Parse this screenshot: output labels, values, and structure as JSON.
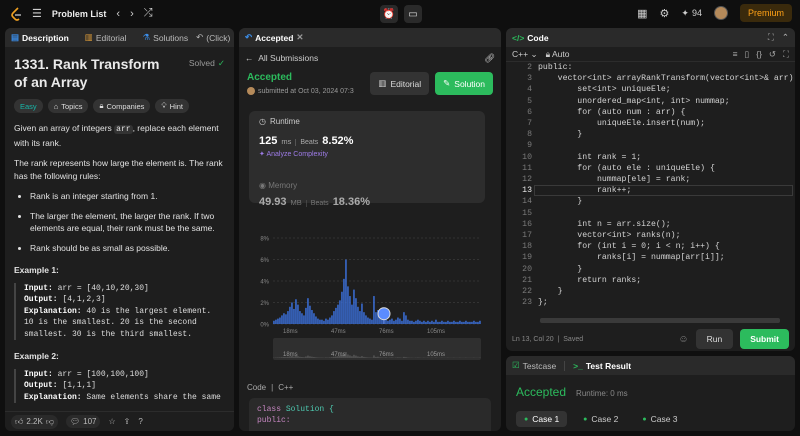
{
  "topbar": {
    "title": "Problem List",
    "streak": "94",
    "premium": "Premium"
  },
  "left": {
    "tabs": [
      "Description",
      "Editorial",
      "Solutions",
      "(Click)"
    ],
    "title": "1331. Rank Transform of an Array",
    "solved": "Solved",
    "chips": [
      "Easy",
      "Topics",
      "Companies",
      "Hint"
    ],
    "desc1a": "Given an array of integers ",
    "desc1code": "arr",
    "desc1b": ", replace each element with its rank.",
    "desc2": "The rank represents how large the element is. The rank has the following rules:",
    "rules": [
      "Rank is an integer starting from 1.",
      "The larger the element, the larger the rank. If two elements are equal, their rank must be the same.",
      "Rank should be as small as possible."
    ],
    "ex1_title": "Example 1:",
    "ex1_input_lbl": "Input:",
    "ex1_input": " arr = [40,10,20,30]",
    "ex1_output_lbl": "Output:",
    "ex1_output": " [4,1,2,3]",
    "ex1_expl_lbl": "Explanation:",
    "ex1_expl": " 40 is the largest element. 10 is the smallest. 20 is the second smallest. 30 is the third smallest.",
    "ex2_title": "Example 2:",
    "ex2_input_lbl": "Input:",
    "ex2_input": " arr = [100,100,100]",
    "ex2_output_lbl": "Output:",
    "ex2_output": " [1,1,1]",
    "ex2_expl_lbl": "Explanation:",
    "ex2_expl": " Same elements share the same",
    "likes": "2.2K",
    "comments": "107"
  },
  "middle": {
    "tab": "Accepted",
    "all_submissions": "All Submissions",
    "status": "Accepted",
    "submitted": "submitted at Oct 03, 2024 07:3",
    "editorial_btn": "Editorial",
    "solution_btn": "Solution",
    "runtime_label": "Runtime",
    "runtime_val": "125",
    "runtime_unit": "ms",
    "beats_label": "Beats",
    "runtime_beats": "8.52%",
    "analyze": "Analyze Complexity",
    "memory_label": "Memory",
    "memory_val": "49.93",
    "memory_unit": "MB",
    "memory_beats": "18.36%",
    "code_label": "Code",
    "code_lang": "C++",
    "code_line1a": "class",
    "code_line1b": " Solution {",
    "code_line2": "public:"
  },
  "chart_data": {
    "type": "bar",
    "title": "",
    "xlabel": "",
    "ylabel": "",
    "y_ticks": [
      "8%",
      "6%",
      "4%",
      "2%",
      "0%"
    ],
    "x_ticks": [
      "18ms",
      "47ms",
      "76ms",
      "105ms"
    ],
    "ylim": [
      0,
      8
    ],
    "values": [
      0.3,
      0.4,
      0.5,
      0.6,
      0.8,
      1.0,
      0.9,
      1.2,
      1.6,
      2.0,
      1.4,
      2.3,
      1.8,
      1.2,
      1.0,
      0.8,
      1.5,
      2.4,
      1.7,
      1.3,
      1.0,
      0.7,
      0.5,
      0.4,
      0.4,
      0.3,
      0.5,
      0.4,
      0.6,
      0.8,
      1.2,
      1.5,
      1.8,
      2.2,
      3.0,
      4.2,
      6.0,
      3.5,
      2.6,
      1.8,
      3.2,
      2.4,
      1.6,
      1.2,
      1.9,
      1.1,
      0.8,
      0.6,
      0.5,
      0.4,
      2.6,
      1.1,
      1.3,
      0.7,
      0.5,
      0.4,
      0.6,
      0.3,
      0.4,
      0.5,
      0.3,
      0.4,
      0.6,
      0.5,
      0.3,
      1.1,
      0.8,
      0.4,
      0.3,
      0.3,
      0.2,
      0.3,
      0.4,
      0.3,
      0.2,
      0.3,
      0.2,
      0.3,
      0.2,
      0.3,
      0.2,
      0.4,
      0.2,
      0.2,
      0.3,
      0.2,
      0.2,
      0.3,
      0.2,
      0.2,
      0.3,
      0.2,
      0.2,
      0.3,
      0.2,
      0.2,
      0.3,
      0.2,
      0.2,
      0.2,
      0.3,
      0.2,
      0.2,
      0.3
    ],
    "highlight_index": 55
  },
  "right": {
    "tab": "Code",
    "lang": "C++",
    "mode": "Auto",
    "lines": [
      "public:",
      "    vector<int> arrayRankTransform(vector<int>& arr) {",
      "        set<int> uniqueEle;",
      "        unordered_map<int, int> nummap;",
      "        for (auto num : arr) {",
      "            uniqueEle.insert(num);",
      "        }",
      "",
      "        int rank = 1;",
      "        for (auto ele : uniqueEle) {",
      "            nummap[ele] = rank;",
      "            rank++;",
      "        }",
      "",
      "        int n = arr.size();",
      "        vector<int> ranks(n);",
      "        for (int i = 0; i < n; i++) {",
      "            ranks[i] = nummap[arr[i]];",
      "        }",
      "        return ranks;",
      "    }",
      "};"
    ],
    "line_numbers": [
      "2",
      "3",
      "4",
      "5",
      "6",
      "7",
      "8",
      "9",
      "10",
      "11",
      "12",
      "13",
      "14",
      "15",
      "16",
      "17",
      "18",
      "19",
      "20",
      "21",
      "22",
      "23"
    ],
    "status": "Ln 13, Col 20",
    "saved": "Saved",
    "run": "Run",
    "submit": "Submit"
  },
  "result": {
    "tab1": "Testcase",
    "tab2": "Test Result",
    "status": "Accepted",
    "runtime": "Runtime: 0 ms",
    "cases": [
      "Case 1",
      "Case 2",
      "Case 3"
    ]
  }
}
